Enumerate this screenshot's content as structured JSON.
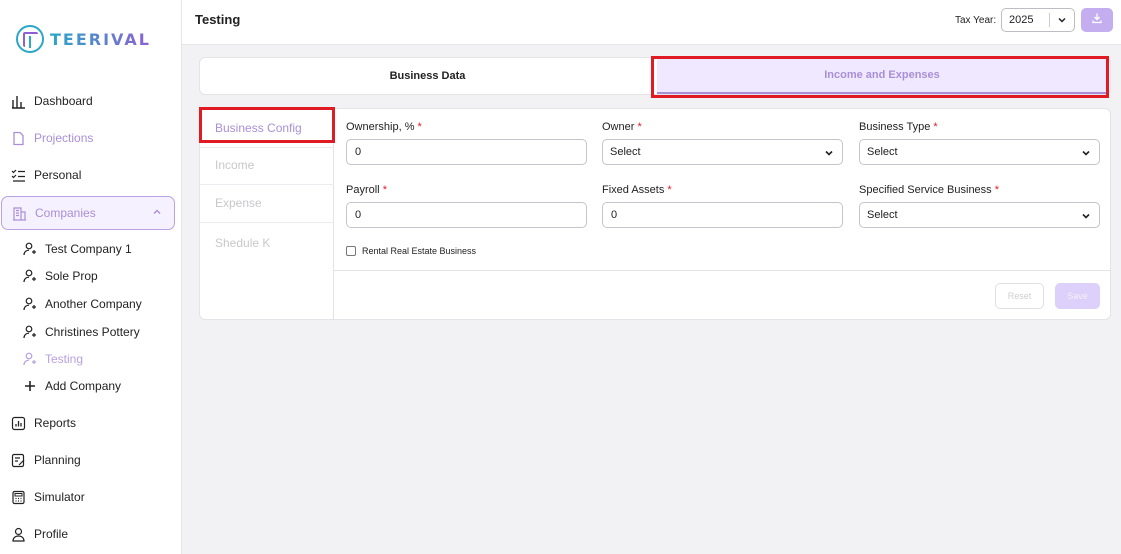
{
  "app": {
    "logo_text": "TEERIVAL"
  },
  "sidebar": {
    "items": [
      {
        "label": "Dashboard",
        "icon": "bar-chart-icon"
      },
      {
        "label": "Projections",
        "icon": "document-icon"
      },
      {
        "label": "Personal",
        "icon": "checklist-icon"
      },
      {
        "label": "Companies",
        "icon": "building-icon"
      },
      {
        "label": "Reports",
        "icon": "report-icon"
      },
      {
        "label": "Planning",
        "icon": "planning-icon"
      },
      {
        "label": "Simulator",
        "icon": "calculator-icon"
      },
      {
        "label": "Profile",
        "icon": "user-icon"
      }
    ],
    "companies": [
      {
        "label": "Test Company 1"
      },
      {
        "label": "Sole Prop"
      },
      {
        "label": "Another Company"
      },
      {
        "label": "Christines Pottery"
      },
      {
        "label": "Testing"
      }
    ],
    "add_company": "Add Company"
  },
  "header": {
    "title": "Testing",
    "tax_year_label": "Tax Year:",
    "tax_year_value": "2025"
  },
  "tabs": [
    {
      "label": "Business Data"
    },
    {
      "label": "Income and Expenses"
    }
  ],
  "side_tabs": [
    {
      "label": "Business Config"
    },
    {
      "label": "Income"
    },
    {
      "label": "Expense"
    },
    {
      "label": "Shedule K"
    }
  ],
  "form": {
    "ownership": {
      "label": "Ownership, %",
      "value": "0"
    },
    "owner": {
      "label": "Owner",
      "value": "Select"
    },
    "business_type": {
      "label": "Business Type",
      "value": "Select"
    },
    "payroll": {
      "label": "Payroll",
      "value": "0"
    },
    "fixed_assets": {
      "label": "Fixed Assets",
      "value": "0"
    },
    "specified_service": {
      "label": "Specified Service Business",
      "value": "Select"
    },
    "rental_checkbox": {
      "label": "Rental Real Estate Business",
      "checked": false
    },
    "required_mark": "*"
  },
  "buttons": {
    "reset": "Reset",
    "save": "Save"
  },
  "colors": {
    "accent": "#a98fd8",
    "highlight": "#e01b24",
    "logo_teal": "#2aa7c9"
  }
}
